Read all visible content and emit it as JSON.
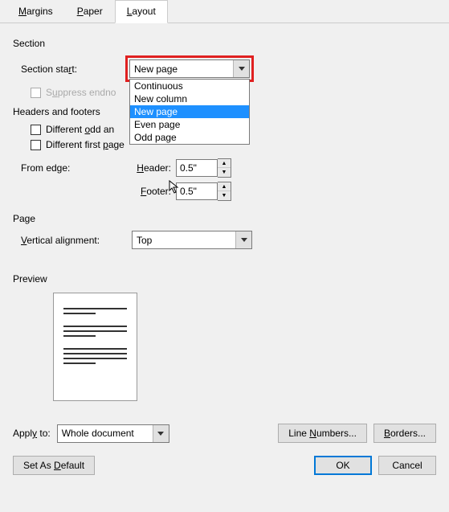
{
  "tabs": {
    "margins": "Margins",
    "paper": "Paper",
    "layout": "Layout"
  },
  "section": {
    "title": "Section",
    "start_label": "Section start:",
    "start_value": "New page",
    "options": [
      "Continuous",
      "New column",
      "New page",
      "Even page",
      "Odd page"
    ],
    "selected_index": 2,
    "suppress_endnotes": "Suppress endnotes"
  },
  "hf": {
    "title": "Headers and footers",
    "diff_odd_even": "Different odd and even",
    "diff_first": "Different first page",
    "from_edge": "From edge:",
    "header_label": "Header:",
    "footer_label": "Footer:",
    "header_val": "0.5\"",
    "footer_val": "0.5\""
  },
  "page": {
    "title": "Page",
    "valign_label": "Vertical alignment:",
    "valign_value": "Top"
  },
  "preview": {
    "title": "Preview"
  },
  "apply": {
    "label": "Apply to:",
    "value": "Whole document",
    "line_numbers": "Line Numbers...",
    "borders": "Borders..."
  },
  "footer": {
    "set_default": "Set As Default",
    "ok": "OK",
    "cancel": "Cancel"
  }
}
